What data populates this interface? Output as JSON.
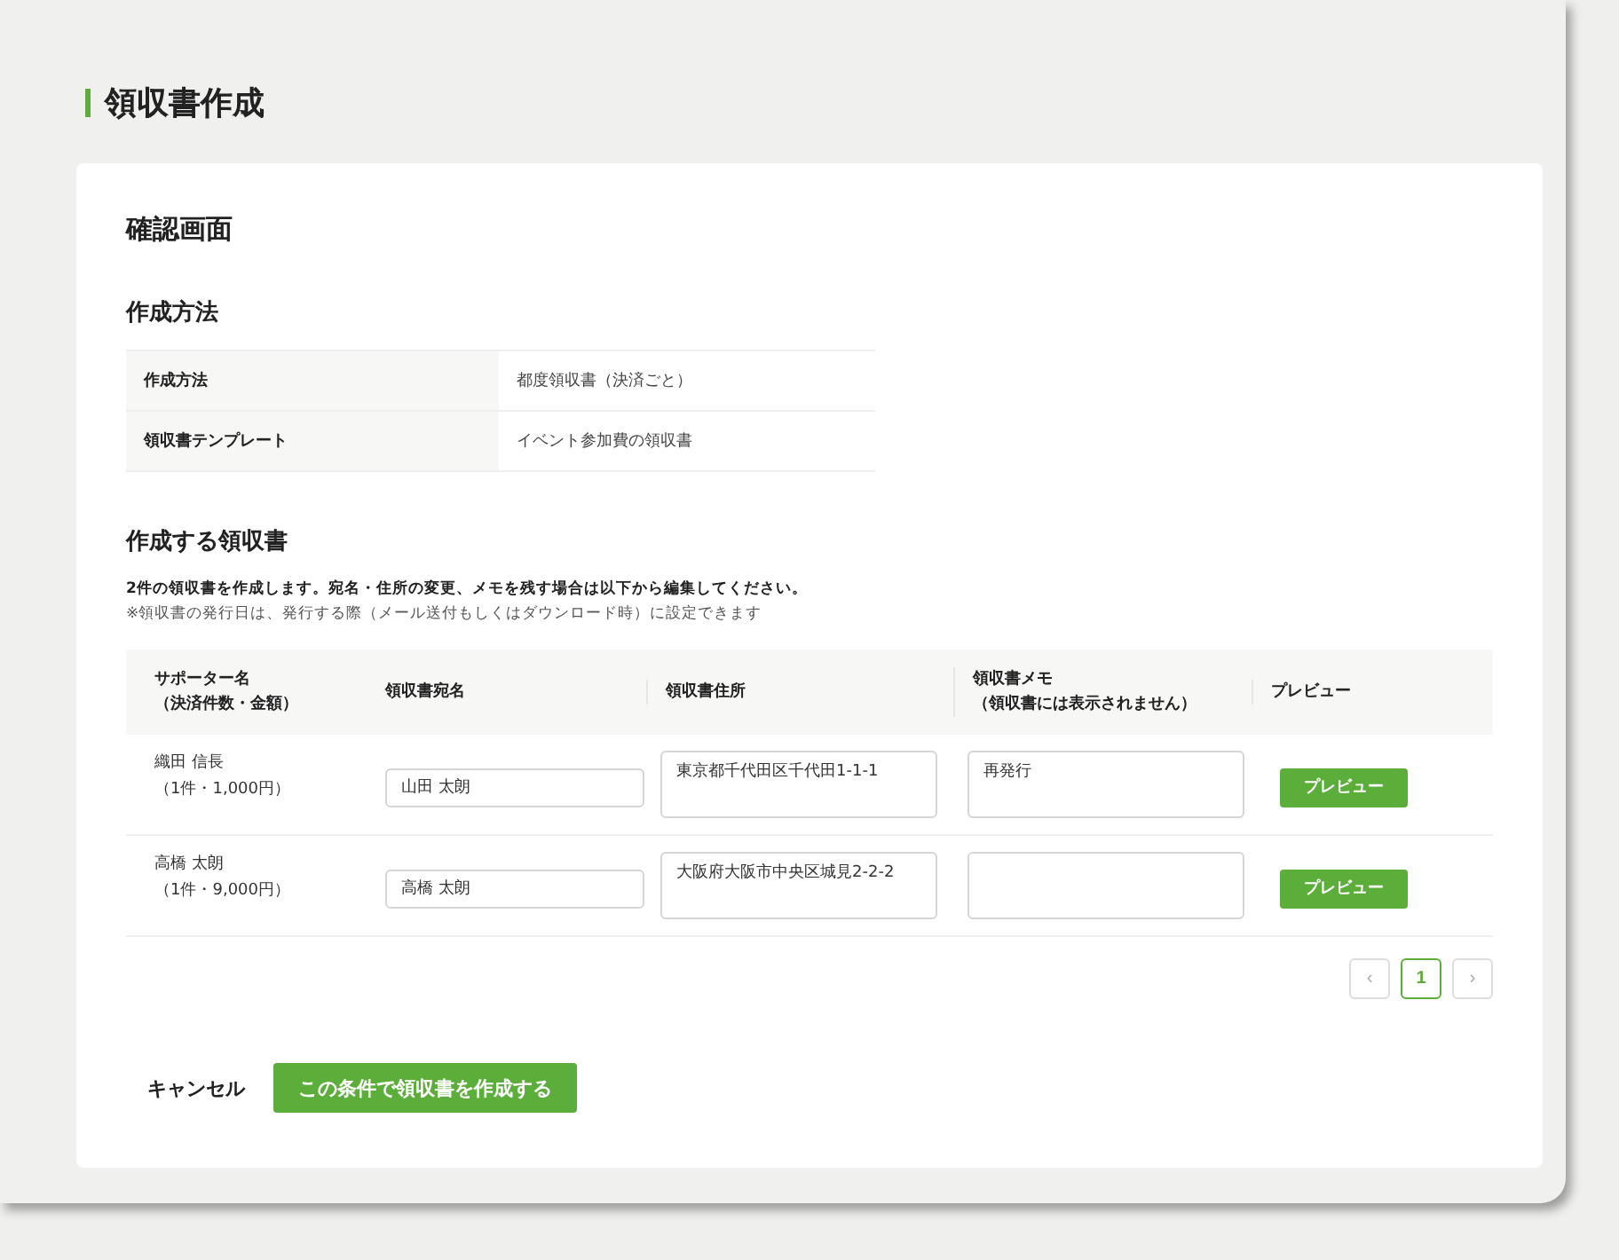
{
  "page_title": "領収書作成",
  "card": {
    "title": "確認画面",
    "method_section": {
      "heading": "作成方法",
      "rows": [
        {
          "label": "作成方法",
          "value": "都度領収書（決済ごと）"
        },
        {
          "label": "領収書テンプレート",
          "value": "イベント参加費の領収書"
        }
      ]
    },
    "receipts_section": {
      "heading": "作成する領収書",
      "note": "2件の領収書を作成します。宛名・住所の変更、メモを残す場合は以下から編集してください。",
      "subnote": "※領収書の発行日は、発行する際（メール送付もしくはダウンロード時）に設定できます",
      "columns": [
        {
          "label": "サポーター名",
          "sublabel": "（決済件数・金額）"
        },
        {
          "label": "領収書宛名"
        },
        {
          "label": "領収書住所"
        },
        {
          "label": "領収書メモ",
          "sublabel": "（領収書には表示されません）"
        },
        {
          "label": "プレビュー"
        }
      ],
      "rows": [
        {
          "supporter": "織田 信長",
          "summary": "（1件・1,000円）",
          "addressee": "山田 太朗",
          "address": "東京都千代田区千代田1-1-1",
          "memo": "再発行",
          "button": "プレビュー"
        },
        {
          "supporter": "高橋 太朗",
          "summary": "（1件・9,000円）",
          "addressee": "高橋 太朗",
          "address": "大阪府大阪市中央区城見2-2-2",
          "button": "プレビュー"
        }
      ],
      "pagination": {
        "prev": "‹",
        "pages": [
          {
            "label": "1",
            "selected": true
          }
        ],
        "next": "›"
      }
    },
    "cancel": "キャンセル",
    "submit": "この条件で領収書を作成する"
  }
}
